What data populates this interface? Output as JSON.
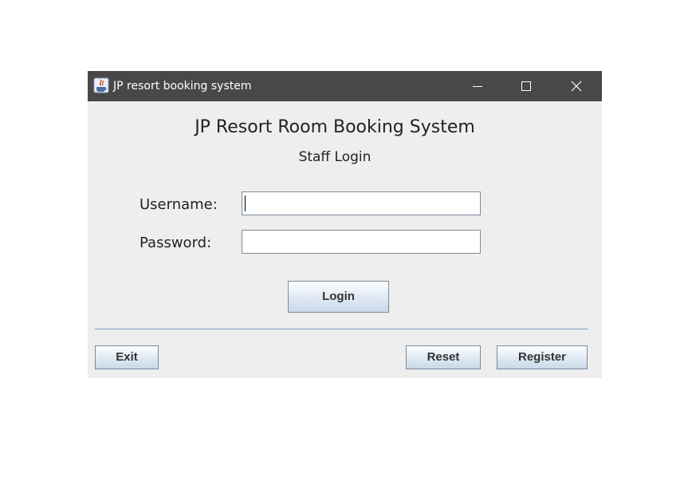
{
  "window": {
    "title": "JP resort booking system",
    "icon": "java-app-icon",
    "controls": [
      "minimize-icon",
      "maximize-icon",
      "close-icon"
    ]
  },
  "form": {
    "heading": "JP Resort Room Booking System",
    "subheading": "Staff Login",
    "username_label": "Username:",
    "username_value": "",
    "password_label": "Password:",
    "password_value": "",
    "login_label": "Login"
  },
  "footer": {
    "exit_label": "Exit",
    "reset_label": "Reset",
    "register_label": "Register"
  },
  "colors": {
    "titlebar": "#494846",
    "panel": "#eeeeee",
    "divider": "#7f9db9"
  }
}
